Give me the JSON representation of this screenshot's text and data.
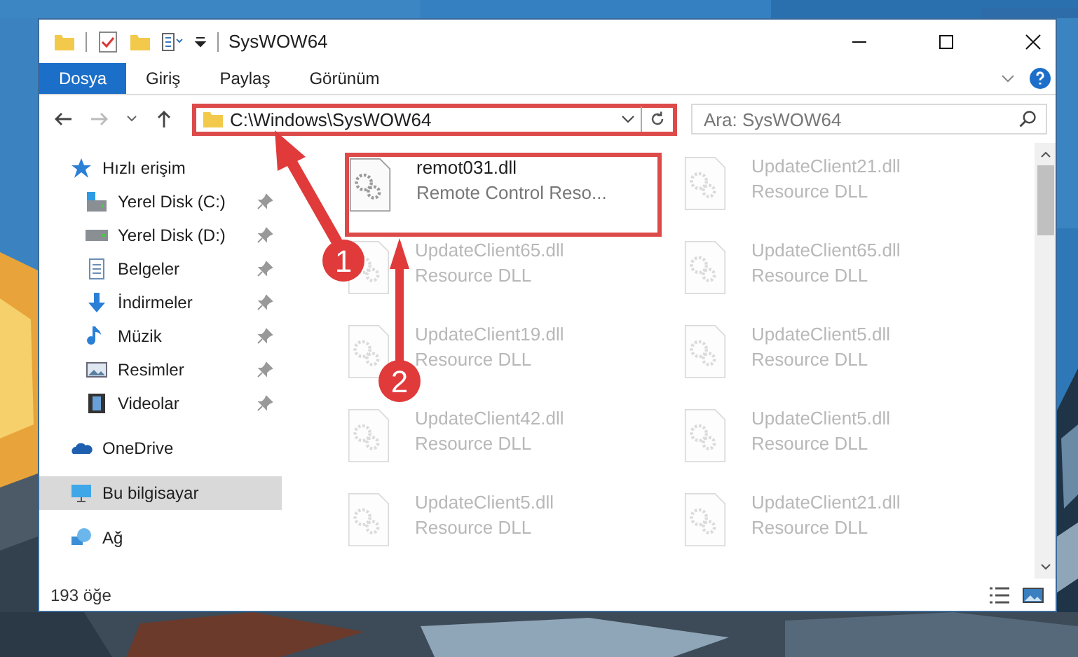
{
  "window": {
    "title": "SysWOW64"
  },
  "ribbon_tabs": [
    {
      "label": "Dosya",
      "selected": true
    },
    {
      "label": "Giriş",
      "selected": false
    },
    {
      "label": "Paylaş",
      "selected": false
    },
    {
      "label": "Görünüm",
      "selected": false
    }
  ],
  "address_bar": {
    "path": "C:\\Windows\\SysWOW64",
    "highlighted": true
  },
  "search": {
    "placeholder": "Ara: SysWOW64"
  },
  "sidebar": [
    {
      "label": "Hızlı erişim",
      "kind": "quick",
      "selected": false,
      "children": [
        {
          "label": "Yerel Disk (C:)",
          "kind": "disk-c",
          "pinned": true
        },
        {
          "label": "Yerel Disk (D:)",
          "kind": "disk",
          "pinned": true
        },
        {
          "label": "Belgeler",
          "kind": "docs",
          "pinned": true
        },
        {
          "label": "İndirmeler",
          "kind": "download",
          "pinned": true
        },
        {
          "label": "Müzik",
          "kind": "music",
          "pinned": true
        },
        {
          "label": "Resimler",
          "kind": "pictures",
          "pinned": true
        },
        {
          "label": "Videolar",
          "kind": "videos",
          "pinned": true
        }
      ]
    },
    {
      "label": "OneDrive",
      "kind": "cloud",
      "selected": false
    },
    {
      "label": "Bu bilgisayar",
      "kind": "pc",
      "selected": true
    },
    {
      "label": "Ağ",
      "kind": "network",
      "selected": false
    }
  ],
  "files": [
    {
      "name": "remot031.dll",
      "type": "Remote Control Reso...",
      "faded": false,
      "highlighted": true
    },
    {
      "name": "UpdateClient21.dll",
      "type": "Resource DLL",
      "faded": true,
      "highlighted": false
    },
    {
      "name": "UpdateClient65.dll",
      "type": "Resource DLL",
      "faded": true,
      "highlighted": false
    },
    {
      "name": "UpdateClient65.dll",
      "type": "Resource DLL",
      "faded": true,
      "highlighted": false
    },
    {
      "name": "UpdateClient19.dll",
      "type": "Resource DLL",
      "faded": true,
      "highlighted": false
    },
    {
      "name": "UpdateClient5.dll",
      "type": "Resource DLL",
      "faded": true,
      "highlighted": false
    },
    {
      "name": "UpdateClient42.dll",
      "type": "Resource DLL",
      "faded": true,
      "highlighted": false
    },
    {
      "name": "UpdateClient5.dll",
      "type": "Resource DLL",
      "faded": true,
      "highlighted": false
    },
    {
      "name": "UpdateClient5.dll",
      "type": "Resource DLL",
      "faded": true,
      "highlighted": false
    },
    {
      "name": "UpdateClient21.dll",
      "type": "Resource DLL",
      "faded": true,
      "highlighted": false
    }
  ],
  "status_bar": {
    "count": "193 öğe"
  },
  "annotations": [
    {
      "number": "1"
    },
    {
      "number": "2"
    }
  ]
}
